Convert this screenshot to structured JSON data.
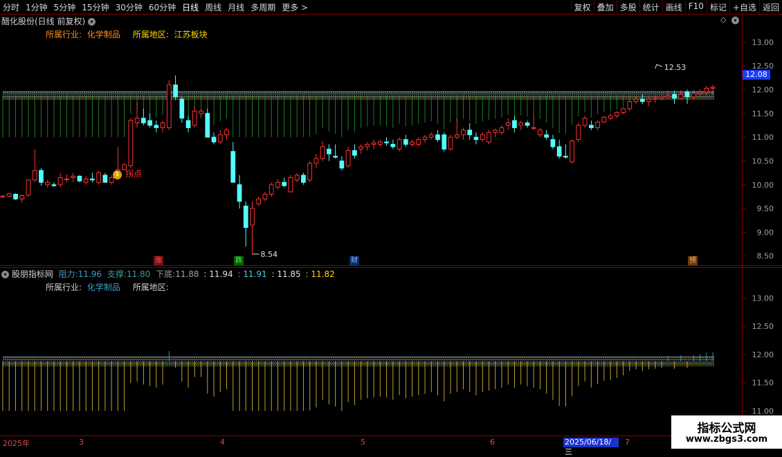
{
  "toolbar": {
    "periods": [
      "分时",
      "1分钟",
      "5分钟",
      "15分钟",
      "30分钟",
      "60分钟",
      "日线",
      "周线",
      "月线",
      "多周期",
      "更多 >"
    ],
    "active_period": "日线",
    "right_buttons": [
      "复权",
      "叠加",
      "多股",
      "统计",
      "画线",
      "F10",
      "标记",
      "+自选",
      "返回"
    ]
  },
  "main_chart": {
    "title": "醋化股份(日线 前复权)",
    "industry_label": "所属行业:",
    "industry_value": "化学制品",
    "region_label": "所属地区:",
    "region_value": "江苏板块",
    "current_price_tag": "12.08",
    "annotation_pivot": "拐点",
    "event_markers": [
      "涨",
      "跌",
      "财",
      "预"
    ]
  },
  "sub_chart": {
    "title": "股朋指标网",
    "resistance_label": "阻力:",
    "resistance_value": "11.96",
    "support_label": "支撑:",
    "support_value": "11.80",
    "floor_label": "下底:",
    "floor_value": "11.88",
    "extra_values": [
      ": 11.94",
      ": 11.91",
      ": 11.85",
      ": 11.82"
    ],
    "industry_label": "所属行业:",
    "industry_value": "化学制品",
    "region_label": "所属地区:"
  },
  "time_axis": {
    "labels": [
      "2025年",
      "3",
      "4",
      "5",
      "6",
      "7"
    ],
    "highlight": "2025/06/18/三"
  },
  "watermark": {
    "line1": "指标公式网",
    "line2": "www.zbgs3.com"
  },
  "chart_data": [
    {
      "type": "candlestick",
      "yticks": [
        8.5,
        9.0,
        9.5,
        10.0,
        10.5,
        11.0,
        11.5,
        12.0,
        12.5,
        13.0
      ],
      "ylim": [
        8.35,
        13.45
      ],
      "high_annotation": "12.53",
      "low_annotation": "8.54",
      "candles": [
        [
          9.75,
          9.78,
          9.72,
          9.76
        ],
        [
          9.76,
          9.83,
          9.74,
          9.81
        ],
        [
          9.8,
          9.82,
          9.68,
          9.7
        ],
        [
          9.7,
          9.79,
          9.62,
          9.77
        ],
        [
          9.78,
          10.12,
          9.75,
          10.1
        ],
        [
          10.1,
          10.75,
          10.05,
          10.3
        ],
        [
          10.3,
          10.35,
          9.98,
          10.05
        ],
        [
          10.0,
          10.1,
          9.95,
          10.05
        ],
        [
          10.0,
          10.05,
          9.95,
          9.98
        ],
        [
          10.0,
          10.25,
          9.95,
          10.15
        ],
        [
          10.12,
          10.22,
          10.05,
          10.12
        ],
        [
          10.15,
          10.25,
          10.05,
          10.18
        ],
        [
          10.18,
          10.2,
          10.05,
          10.08
        ],
        [
          10.05,
          10.18,
          10.0,
          10.12
        ],
        [
          10.12,
          10.25,
          10.05,
          10.1
        ],
        [
          10.05,
          10.3,
          10.0,
          10.25
        ],
        [
          10.2,
          10.25,
          10.05,
          10.05
        ],
        [
          10.05,
          10.2,
          10.0,
          10.15
        ],
        [
          10.15,
          10.8,
          10.1,
          10.32
        ],
        [
          10.32,
          10.45,
          10.3,
          10.42
        ],
        [
          10.4,
          11.4,
          10.35,
          11.35
        ],
        [
          11.3,
          11.75,
          11.2,
          11.4
        ],
        [
          11.4,
          11.6,
          11.25,
          11.3
        ],
        [
          11.35,
          11.5,
          11.2,
          11.25
        ],
        [
          11.25,
          11.35,
          11.1,
          11.2
        ],
        [
          11.2,
          11.35,
          11.1,
          11.3
        ],
        [
          11.2,
          12.2,
          11.15,
          12.1
        ],
        [
          12.1,
          12.3,
          11.8,
          11.85
        ],
        [
          11.8,
          11.85,
          11.3,
          11.4
        ],
        [
          11.35,
          11.45,
          11.1,
          11.2
        ],
        [
          11.25,
          11.65,
          11.2,
          11.55
        ],
        [
          11.5,
          11.6,
          11.4,
          11.55
        ],
        [
          11.5,
          11.6,
          11.0,
          11.0
        ],
        [
          11.0,
          11.1,
          10.85,
          10.9
        ],
        [
          10.9,
          11.15,
          10.85,
          11.05
        ],
        [
          11.05,
          11.2,
          10.95,
          11.15
        ],
        [
          10.7,
          10.9,
          10.05,
          10.05
        ],
        [
          10.0,
          10.2,
          9.5,
          9.65
        ],
        [
          9.55,
          9.65,
          8.7,
          9.1
        ],
        [
          9.15,
          9.65,
          8.54,
          9.5
        ],
        [
          9.6,
          9.75,
          9.55,
          9.7
        ],
        [
          9.7,
          9.85,
          9.65,
          9.8
        ],
        [
          9.8,
          10.05,
          9.75,
          10.0
        ],
        [
          9.95,
          10.12,
          9.9,
          10.05
        ],
        [
          10.05,
          10.15,
          9.95,
          9.98
        ],
        [
          9.85,
          10.2,
          9.85,
          10.15
        ],
        [
          10.1,
          10.25,
          10.05,
          10.2
        ],
        [
          10.2,
          10.25,
          10.0,
          10.05
        ],
        [
          10.1,
          10.5,
          10.05,
          10.45
        ],
        [
          10.45,
          10.65,
          10.35,
          10.55
        ],
        [
          10.55,
          10.92,
          10.5,
          10.8
        ],
        [
          10.75,
          10.85,
          10.5,
          10.65
        ],
        [
          10.6,
          10.85,
          10.55,
          10.58
        ],
        [
          10.5,
          10.6,
          10.3,
          10.35
        ],
        [
          10.4,
          10.8,
          10.35,
          10.72
        ],
        [
          10.72,
          10.85,
          10.55,
          10.62
        ],
        [
          10.75,
          10.85,
          10.65,
          10.8
        ],
        [
          10.8,
          10.9,
          10.72,
          10.85
        ],
        [
          10.85,
          10.95,
          10.75,
          10.88
        ],
        [
          10.85,
          10.95,
          10.8,
          10.9
        ],
        [
          10.9,
          11.0,
          10.82,
          10.88
        ],
        [
          10.85,
          10.95,
          10.75,
          10.8
        ],
        [
          10.75,
          11.0,
          10.7,
          10.95
        ],
        [
          10.95,
          11.05,
          10.8,
          10.85
        ],
        [
          10.85,
          10.95,
          10.8,
          10.9
        ],
        [
          10.85,
          11.0,
          10.8,
          10.95
        ],
        [
          10.95,
          11.05,
          10.88,
          11.0
        ],
        [
          11.0,
          11.1,
          10.95,
          11.05
        ],
        [
          11.05,
          11.15,
          10.9,
          10.95
        ],
        [
          11.05,
          11.1,
          10.7,
          10.75
        ],
        [
          10.75,
          11.05,
          10.72,
          11.0
        ],
        [
          11.0,
          11.4,
          10.95,
          11.05
        ],
        [
          11.05,
          11.2,
          10.95,
          11.15
        ],
        [
          11.15,
          11.3,
          10.95,
          11.05
        ],
        [
          11.0,
          11.1,
          10.85,
          10.95
        ],
        [
          10.95,
          11.1,
          10.9,
          11.05
        ],
        [
          10.9,
          11.15,
          10.85,
          11.1
        ],
        [
          11.1,
          11.18,
          11.0,
          11.15
        ],
        [
          11.1,
          11.25,
          11.05,
          11.2
        ],
        [
          11.25,
          11.4,
          11.15,
          11.3
        ],
        [
          11.35,
          11.45,
          11.1,
          11.2
        ],
        [
          11.25,
          11.35,
          11.15,
          11.3
        ],
        [
          11.3,
          11.35,
          11.2,
          11.25
        ],
        [
          11.2,
          11.45,
          11.15,
          11.2
        ],
        [
          11.05,
          11.2,
          11.0,
          11.15
        ],
        [
          11.05,
          11.15,
          10.95,
          11.0
        ],
        [
          10.95,
          11.05,
          10.75,
          10.8
        ],
        [
          10.8,
          10.95,
          10.55,
          10.6
        ],
        [
          10.6,
          10.85,
          10.55,
          10.58
        ],
        [
          10.48,
          10.95,
          10.45,
          10.92
        ],
        [
          10.95,
          11.3,
          10.9,
          11.25
        ],
        [
          11.25,
          11.45,
          11.2,
          11.4
        ],
        [
          11.25,
          11.35,
          11.15,
          11.2
        ],
        [
          11.2,
          11.35,
          11.15,
          11.32
        ],
        [
          11.32,
          11.45,
          11.3,
          11.42
        ],
        [
          11.4,
          11.5,
          11.35,
          11.45
        ],
        [
          11.45,
          11.55,
          11.4,
          11.52
        ],
        [
          11.52,
          11.62,
          11.48,
          11.6
        ],
        [
          11.6,
          11.8,
          11.55,
          11.75
        ],
        [
          11.75,
          11.85,
          11.7,
          11.8
        ],
        [
          11.8,
          11.9,
          11.7,
          11.75
        ],
        [
          11.75,
          11.85,
          11.65,
          11.8
        ],
        [
          11.8,
          11.88,
          11.72,
          11.82
        ],
        [
          11.82,
          11.9,
          11.78,
          11.85
        ],
        [
          11.85,
          11.95,
          11.8,
          11.88
        ],
        [
          11.9,
          11.98,
          11.7,
          11.82
        ],
        [
          11.82,
          11.95,
          11.8,
          11.9
        ],
        [
          11.95,
          12.0,
          11.7,
          11.85
        ],
        [
          11.85,
          11.95,
          11.8,
          11.92
        ],
        [
          11.92,
          12.0,
          11.88,
          11.95
        ],
        [
          11.95,
          12.08,
          11.9,
          12.03
        ],
        [
          12.03,
          12.1,
          11.98,
          12.05
        ]
      ]
    },
    {
      "type": "bar",
      "title": "股朋指标网",
      "yticks": [
        11.0,
        11.5,
        12.0,
        12.5,
        13.0
      ],
      "ylim": [
        10.6,
        13.35
      ],
      "levels": [
        11.96,
        11.94,
        11.91,
        11.88,
        11.85,
        11.82,
        11.8
      ]
    }
  ]
}
